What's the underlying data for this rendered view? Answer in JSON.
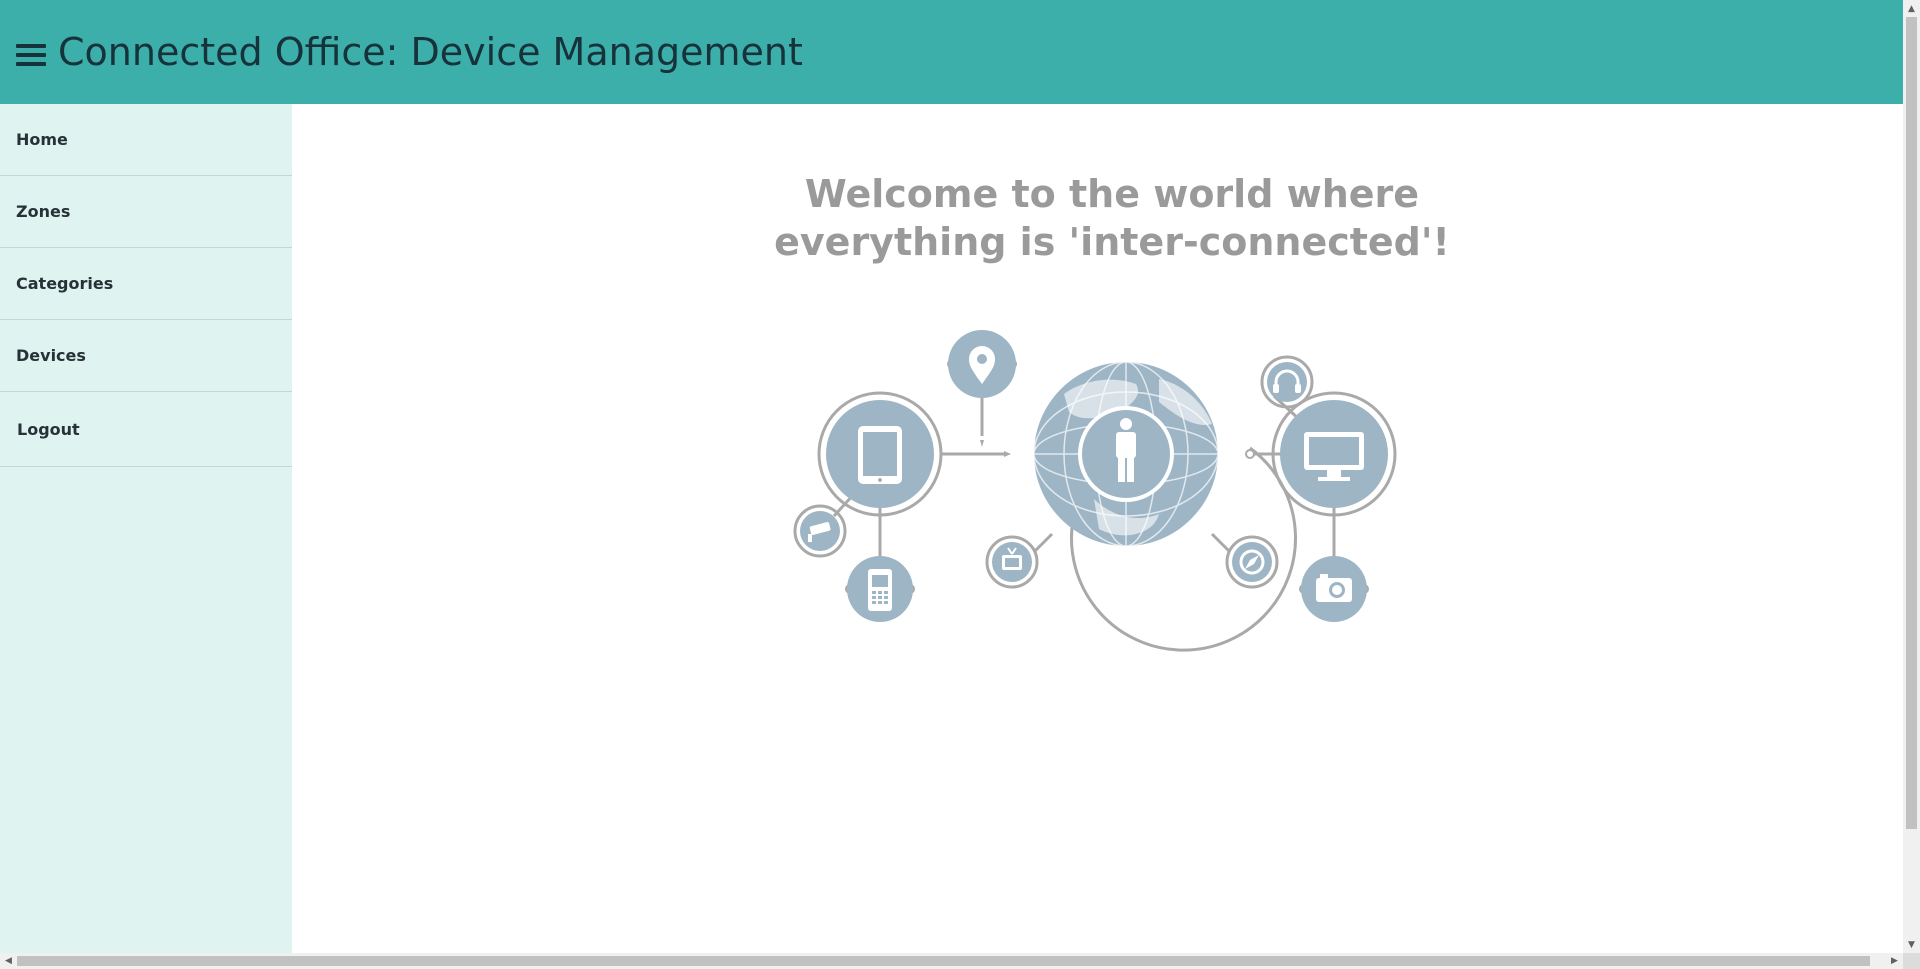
{
  "header": {
    "title": "Connected Office: Device Management",
    "background": "#3dafab",
    "menu_icon": "hamburger-menu-icon"
  },
  "sidebar": {
    "background": "#dff3f0",
    "items": [
      {
        "label": "Home"
      },
      {
        "label": "Zones"
      },
      {
        "label": "Categories"
      },
      {
        "label": "Devices"
      },
      {
        "label": "Logout"
      }
    ]
  },
  "main": {
    "welcome_line1": "Welcome to the world where",
    "welcome_line2": "everything is 'inter-connected'!",
    "illustration": {
      "accent": "#9db5c5",
      "ring": "#a9a9a9",
      "icons": [
        "map-pin-icon",
        "tablet-icon",
        "globe-icon",
        "person-icon",
        "monitor-icon",
        "headphones-icon",
        "cctv-camera-icon",
        "mobile-phone-icon",
        "tv-icon",
        "compass-icon",
        "camera-icon"
      ]
    }
  }
}
